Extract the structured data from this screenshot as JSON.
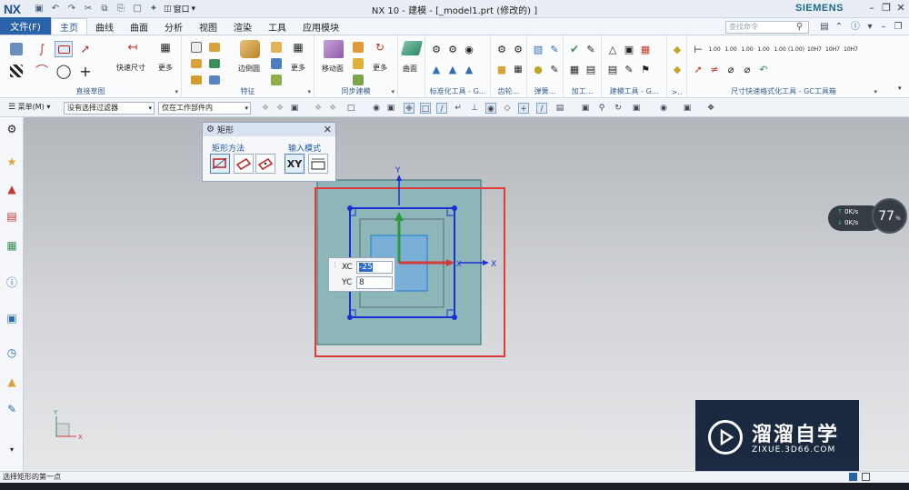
{
  "titlebar": {
    "logo": "NX",
    "window_menu": "窗口",
    "title": "NX 10 - 建模 - [_model1.prt  (修改的) ]",
    "brand": "SIEMENS"
  },
  "menubar": {
    "file": "文件(F)",
    "tabs": [
      "主页",
      "曲线",
      "曲面",
      "分析",
      "视图",
      "渲染",
      "工具",
      "应用模块"
    ],
    "active_tab": "主页",
    "search_placeholder": "查找命令"
  },
  "ribbon": {
    "groups": [
      {
        "label": "直接草图",
        "buttons": [
          "快速尺寸",
          "更多"
        ]
      },
      {
        "label": "特征",
        "buttons": [
          "边倒圆",
          "更多"
        ]
      },
      {
        "label": "同步建模",
        "buttons": [
          "移动面",
          "更多"
        ]
      },
      {
        "label": "",
        "buttons": [
          "曲面"
        ]
      },
      {
        "label": "标准化工具 - G...",
        "buttons": []
      },
      {
        "label": "齿轮...",
        "buttons": []
      },
      {
        "label": "弹簧...",
        "buttons": []
      },
      {
        "label": "加工...",
        "buttons": []
      },
      {
        "label": "建模工具 - G...",
        "buttons": []
      },
      {
        "label": ">..",
        "buttons": []
      },
      {
        "label": "尺寸快速格式化工具 - GC工具箱",
        "buttons": []
      }
    ]
  },
  "seltoolbar": {
    "menu": "菜单(M)",
    "filter": "没有选择过滤器",
    "scope": "仅在工作部件内"
  },
  "rect_dialog": {
    "title": "矩形",
    "method_header": "矩形方法",
    "input_header": "输入模式",
    "xy_label": "XY"
  },
  "coord_input": {
    "xc_label": "XC",
    "xc_value": "-25",
    "yc_label": "YC",
    "yc_value": "8"
  },
  "axis_labels": {
    "x": "X",
    "y": "Y",
    "xc": "X"
  },
  "perf": {
    "up": "0K/s",
    "down": "0K/s",
    "percent": "77",
    "unit": "%"
  },
  "watermark": {
    "text": "溜溜自学",
    "url": "ZIXUE.3D66.COM"
  },
  "status": {
    "message": "选择矩形的第一点"
  },
  "colors": {
    "accent": "#2a62a9",
    "sketch_blue": "#1a2fd6",
    "selection_red": "#e03a3a",
    "face_teal": "#8db6b9"
  }
}
